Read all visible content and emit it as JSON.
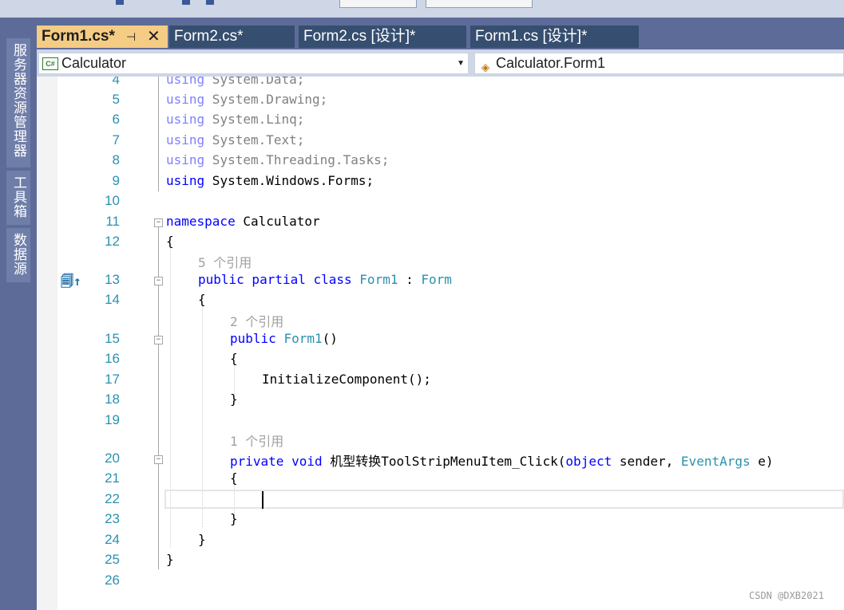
{
  "side_panels": [
    "服务器资源管理器",
    "工具箱",
    "数据源"
  ],
  "tabs": [
    {
      "label": "Form1.cs*",
      "active": true
    },
    {
      "label": "Form2.cs*"
    },
    {
      "label": "Form2.cs [设计]*"
    },
    {
      "label": "Form1.cs [设计]*"
    }
  ],
  "tab_icons": {
    "pin": "⊣",
    "close": "✕"
  },
  "nav": {
    "project_badge": "C#",
    "project": "Calculator",
    "class_icon": "◈",
    "class": "Calculator.Form1"
  },
  "line_numbers": [
    "4",
    "5",
    "6",
    "7",
    "8",
    "9",
    "10",
    "11",
    "12",
    "13",
    "14",
    "15",
    "16",
    "17",
    "18",
    "19",
    "20",
    "21",
    "22",
    "23",
    "24",
    "25",
    "26"
  ],
  "code": {
    "l4": {
      "kw": "using",
      "rest": " System.Data;"
    },
    "l5": {
      "kw": "using",
      "rest": " System.Drawing;"
    },
    "l6": {
      "kw": "using",
      "rest": " System.Linq;"
    },
    "l7": {
      "kw": "using",
      "rest": " System.Text;"
    },
    "l8": {
      "kw": "using",
      "rest": " System.Threading.Tasks;"
    },
    "l9": {
      "kw": "using",
      "rest": " System.Windows.Forms;"
    },
    "l11": {
      "kw": "namespace",
      "rest": " Calculator"
    },
    "l12": "{",
    "lens1": "5 个引用",
    "l13": {
      "kw": "public partial class",
      "type": "Form1",
      "mid": " : ",
      "base": "Form"
    },
    "l14": "{",
    "lens2": "2 个引用",
    "l15": {
      "kw": "public",
      "type": "Form1",
      "rest": "()"
    },
    "l16": "{",
    "l17": "InitializeComponent();",
    "l18": "}",
    "lens3": "1 个引用",
    "l20": {
      "kw": "private void",
      "name": " 机型转换ToolStripMenuItem_Click(",
      "kw2": "object",
      "mid": " sender, ",
      "type": "EventArgs",
      "rest": " e)"
    },
    "l21": "{",
    "l23": "}",
    "l24": "}",
    "l25": "}"
  },
  "watermark": "CSDN @DXB2021"
}
